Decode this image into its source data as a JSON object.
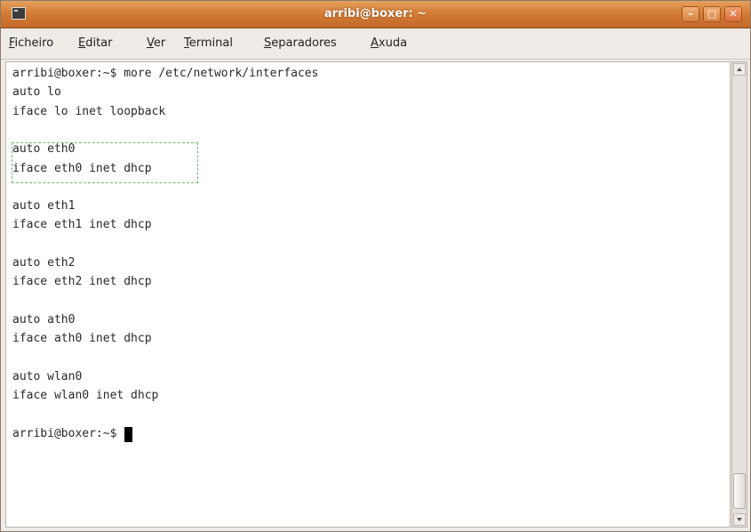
{
  "window": {
    "title": "arribi@boxer: ~",
    "minimize_glyph": "–",
    "maximize_glyph": "□",
    "close_glyph": "✕"
  },
  "menubar": {
    "items": [
      {
        "mnemonic": "F",
        "rest": "icheiro"
      },
      {
        "mnemonic": "E",
        "rest": "ditar"
      },
      {
        "mnemonic": "V",
        "rest": "er"
      },
      {
        "mnemonic": "T",
        "rest": "erminal"
      },
      {
        "mnemonic": "S",
        "rest": "eparadores"
      },
      {
        "mnemonic": "A",
        "rest": "xuda"
      }
    ]
  },
  "terminal": {
    "lines": [
      "arribi@boxer:~$ more /etc/network/interfaces",
      "auto lo",
      "iface lo inet loopback",
      "",
      "auto eth0",
      "iface eth0 inet dhcp",
      "",
      "auto eth1",
      "iface eth1 inet dhcp",
      "",
      "auto eth2",
      "iface eth2 inet dhcp",
      "",
      "auto ath0",
      "iface ath0 inet dhcp",
      "",
      "auto wlan0",
      "iface wlan0 inet dhcp",
      "",
      "arribi@boxer:~$ "
    ],
    "highlighted_lines": [
      4,
      5
    ],
    "highlight_color": "#72b872",
    "text_color": "#2a2a2a",
    "background": "#ffffff"
  },
  "colors": {
    "titlebar": "#d47d35",
    "chrome": "#efebe7"
  },
  "icons": {
    "app_icon": "terminal-icon",
    "scroll_up": "scroll-up-icon",
    "scroll_down": "scroll-down-icon"
  }
}
